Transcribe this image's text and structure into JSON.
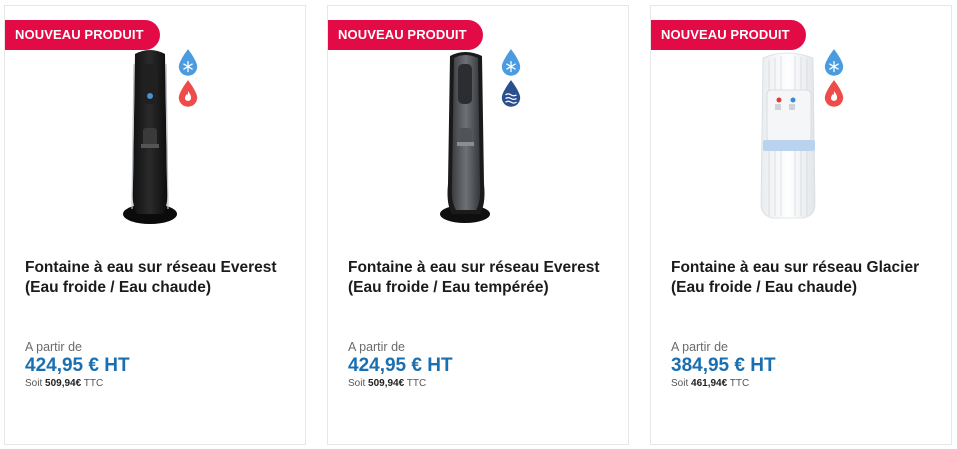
{
  "badge_label": "NOUVEAU PRODUIT",
  "colors": {
    "badge": "#e30b46",
    "price": "#1a6fb1",
    "cold_icon": "#4b9be0",
    "hot_icon": "#ee4b4b",
    "tempered_icon": "#2b4f8e"
  },
  "products": [
    {
      "title": "Fontaine à eau sur réseau Everest (Eau froide / Eau chaude)",
      "from_label": "A partir de",
      "price_ht": "424,95 € HT",
      "ttc_prefix": "Soit",
      "ttc_value": "509,94€",
      "ttc_suffix": "TTC",
      "icons": [
        "cold-water-icon",
        "hot-water-icon"
      ]
    },
    {
      "title": "Fontaine à eau sur réseau Everest (Eau froide / Eau tempérée)",
      "from_label": "A partir de",
      "price_ht": "424,95 € HT",
      "ttc_prefix": "Soit",
      "ttc_value": "509,94€",
      "ttc_suffix": "TTC",
      "icons": [
        "cold-water-icon",
        "tempered-water-icon"
      ]
    },
    {
      "title": "Fontaine à eau sur réseau Glacier (Eau froide / Eau chaude)",
      "from_label": "A partir de",
      "price_ht": "384,95 € HT",
      "ttc_prefix": "Soit",
      "ttc_value": "461,94€",
      "ttc_suffix": "TTC",
      "icons": [
        "cold-water-icon",
        "hot-water-icon"
      ]
    }
  ]
}
